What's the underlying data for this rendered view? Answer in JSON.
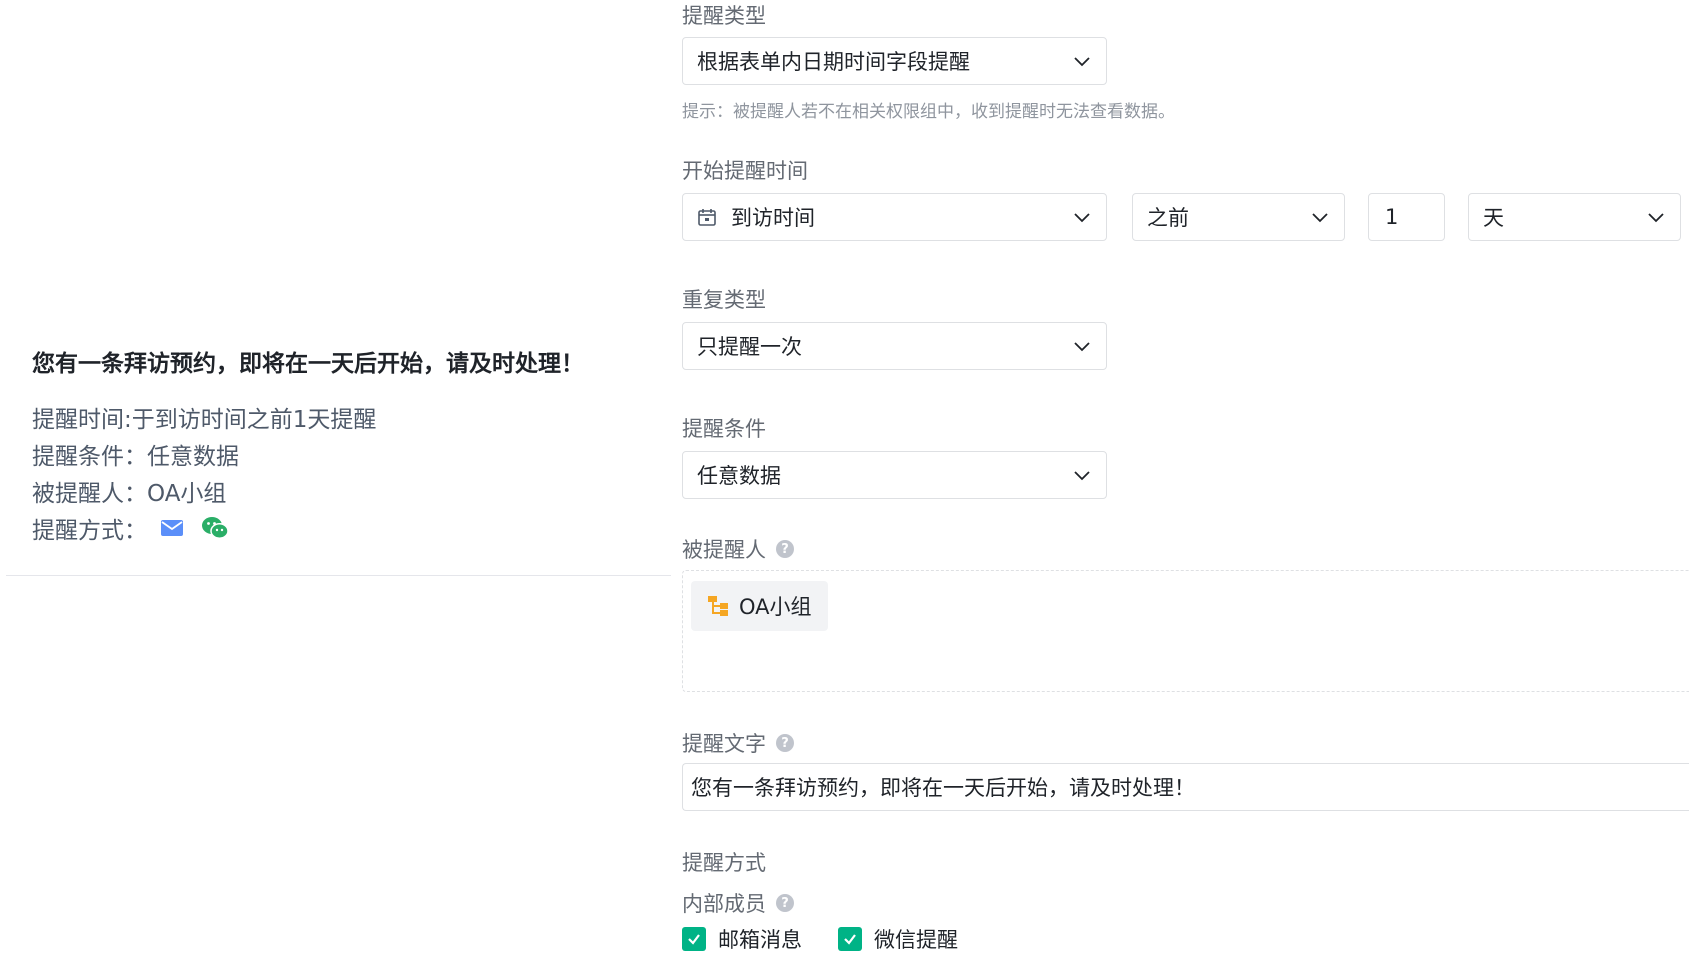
{
  "summary": {
    "title": "您有一条拜访预约，即将在一天后开始，请及时处理！",
    "time_key": "提醒时间: ",
    "time_value": "于到访时间之前1天提醒",
    "condition_key": "提醒条件：",
    "condition_value": "任意数据",
    "assignee_key": "被提醒人：",
    "assignee_value": "OA小组",
    "method_key": "提醒方式：",
    "method_icons": [
      "mail-icon",
      "wechat-icon"
    ]
  },
  "form": {
    "reminder_type_label": "提醒类型",
    "reminder_type_value": "根据表单内日期时间字段提醒",
    "hint": "提示：被提醒人若不在相关权限组中，收到提醒时无法查看数据。",
    "start_time_label": "开始提醒时间",
    "start_field_value": "到访时间",
    "start_relation_value": "之前",
    "start_amount_value": "1",
    "start_unit_value": "天",
    "repeat_label": "重复类型",
    "repeat_value": "只提醒一次",
    "condition_label": "提醒条件",
    "condition_value": "任意数据",
    "assignee_label": "被提醒人",
    "assignee_tag": "OA小组",
    "text_label": "提醒文字",
    "text_value": "您有一条拜访预约，即将在一天后开始，请及时处理！",
    "method_label": "提醒方式",
    "internal_label": "内部成员",
    "email_label": "邮箱消息",
    "wechat_label": "微信提醒"
  },
  "colors": {
    "accent_green": "#00b386",
    "mail_blue": "#5b8ff9",
    "wechat_green": "#2aae67",
    "org_orange": "#f5a623"
  }
}
